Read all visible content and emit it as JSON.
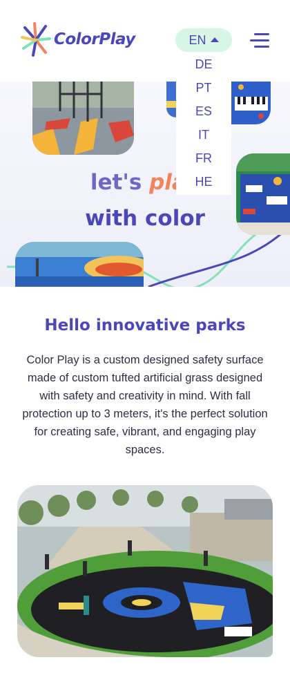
{
  "header": {
    "logo_text": "ColorPlay",
    "language": {
      "current": "EN",
      "options": [
        "DE",
        "PT",
        "ES",
        "IT",
        "FR",
        "HE"
      ]
    }
  },
  "hero": {
    "line1_prefix": "let's ",
    "line1_highlight": "play",
    "line2": "with color"
  },
  "intro": {
    "title": "Hello innovative parks",
    "body": "Color Play is a custom designed safety surface made of custom tufted artificial grass designed with safety and creativity in mind. With fall protection up to 3 meters, it's the perfect solution for creating safe, vibrant, and engaging play spaces."
  },
  "colors": {
    "brand_primary": "#4b47b8",
    "accent_orange": "#f2835a",
    "accent_mint": "#d7f6e5",
    "wave_mint": "#7fe3b8"
  },
  "icons": {
    "logo": "colorplay-burst-icon",
    "language_toggle": "caret-up-icon",
    "menu": "hamburger-menu-icon"
  }
}
